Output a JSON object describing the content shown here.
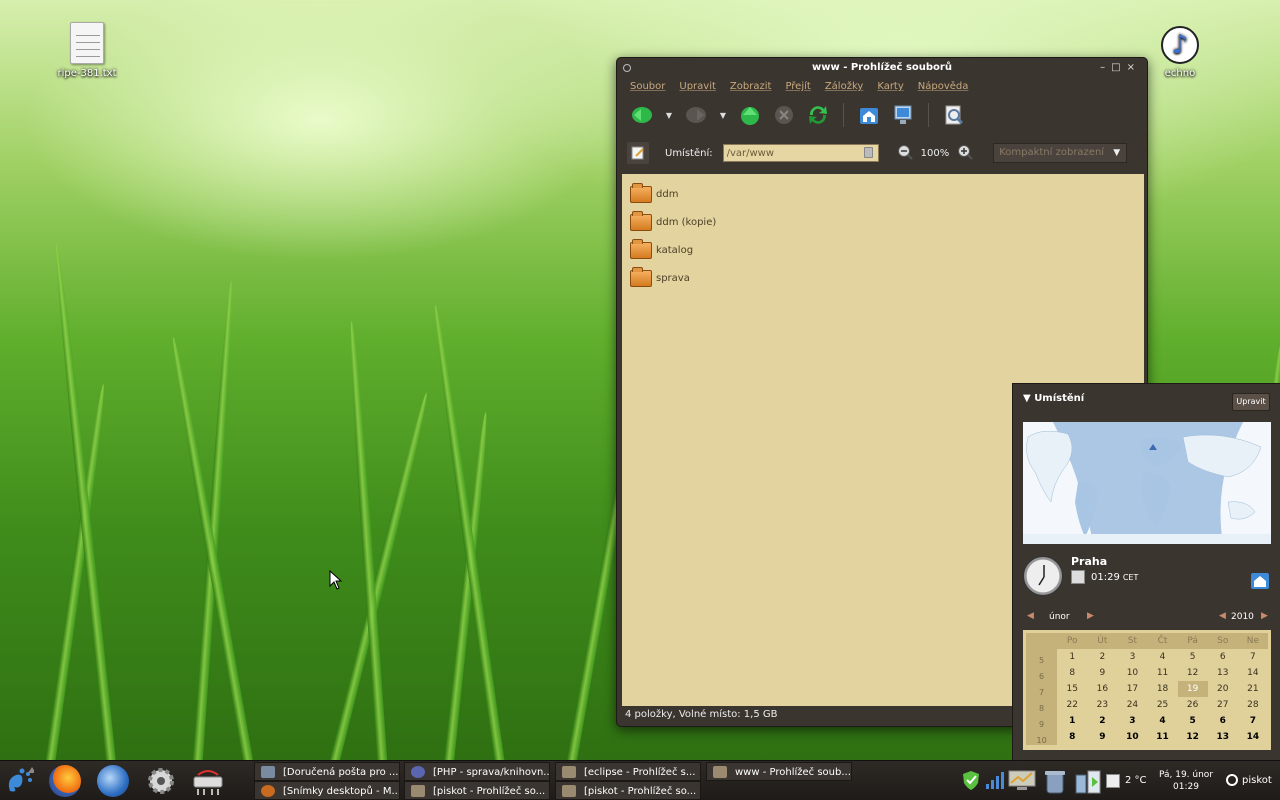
{
  "desktop": {
    "icons": [
      {
        "label": "ripe-381.txt",
        "icon": "text-file-icon"
      },
      {
        "label": "echno",
        "icon": "music-note-icon"
      }
    ]
  },
  "file_manager": {
    "title": "www - Prohlížeč souborů",
    "menu": [
      "Soubor",
      "Upravit",
      "Zobrazit",
      "Přejít",
      "Záložky",
      "Karty",
      "Nápověda"
    ],
    "location_label": "Umístění:",
    "location_value": "/var/www",
    "zoom": "100%",
    "view_mode": "Kompaktní zobrazení",
    "items": [
      "ddm",
      "ddm (kopie)",
      "katalog",
      "sprava"
    ],
    "status": "4 položky, Volné místo: 1,5 GB"
  },
  "calendar_panel": {
    "heading": "Umístění",
    "edit_label": "Upravit",
    "city": "Praha",
    "time": "01:29",
    "tz": "CET",
    "month": "únor",
    "year": "2010",
    "weekdays": [
      "Po",
      "Út",
      "St",
      "Čt",
      "Pá",
      "So",
      "Ne"
    ],
    "weeks": [
      {
        "no": "5",
        "days": [
          "1",
          "2",
          "3",
          "4",
          "5",
          "6",
          "7"
        ]
      },
      {
        "no": "6",
        "days": [
          "8",
          "9",
          "10",
          "11",
          "12",
          "13",
          "14"
        ]
      },
      {
        "no": "7",
        "days": [
          "15",
          "16",
          "17",
          "18",
          "19",
          "20",
          "21"
        ]
      },
      {
        "no": "8",
        "days": [
          "22",
          "23",
          "24",
          "25",
          "26",
          "27",
          "28"
        ]
      },
      {
        "no": "9",
        "days": [
          "1",
          "2",
          "3",
          "4",
          "5",
          "6",
          "7"
        ]
      },
      {
        "no": "10",
        "days": [
          "8",
          "9",
          "10",
          "11",
          "12",
          "13",
          "14"
        ]
      }
    ],
    "today": "19"
  },
  "taskbar": {
    "tasks_top": [
      {
        "label": "[Doručená pošta pro ...",
        "color": "#7a8aa0"
      },
      {
        "label": "[PHP - sprava/knihovn...",
        "color": "#5a66b0"
      },
      {
        "label": "[eclipse - Prohlížeč s...",
        "color": "#9a8a70"
      },
      {
        "label": "www - Prohlížeč soub...",
        "color": "#9a8a70"
      }
    ],
    "tasks_bottom": [
      {
        "label": "[Snímky desktopů - M...",
        "color": "#c86a20"
      },
      {
        "label": "[piskot - Prohlížeč so...",
        "color": "#9a8a70"
      },
      {
        "label": "[piskot - Prohlížeč so...",
        "color": "#9a8a70"
      }
    ],
    "temperature": "2 °C",
    "date": "Pá, 19. únor",
    "time": "01:29",
    "user": "piskot"
  }
}
